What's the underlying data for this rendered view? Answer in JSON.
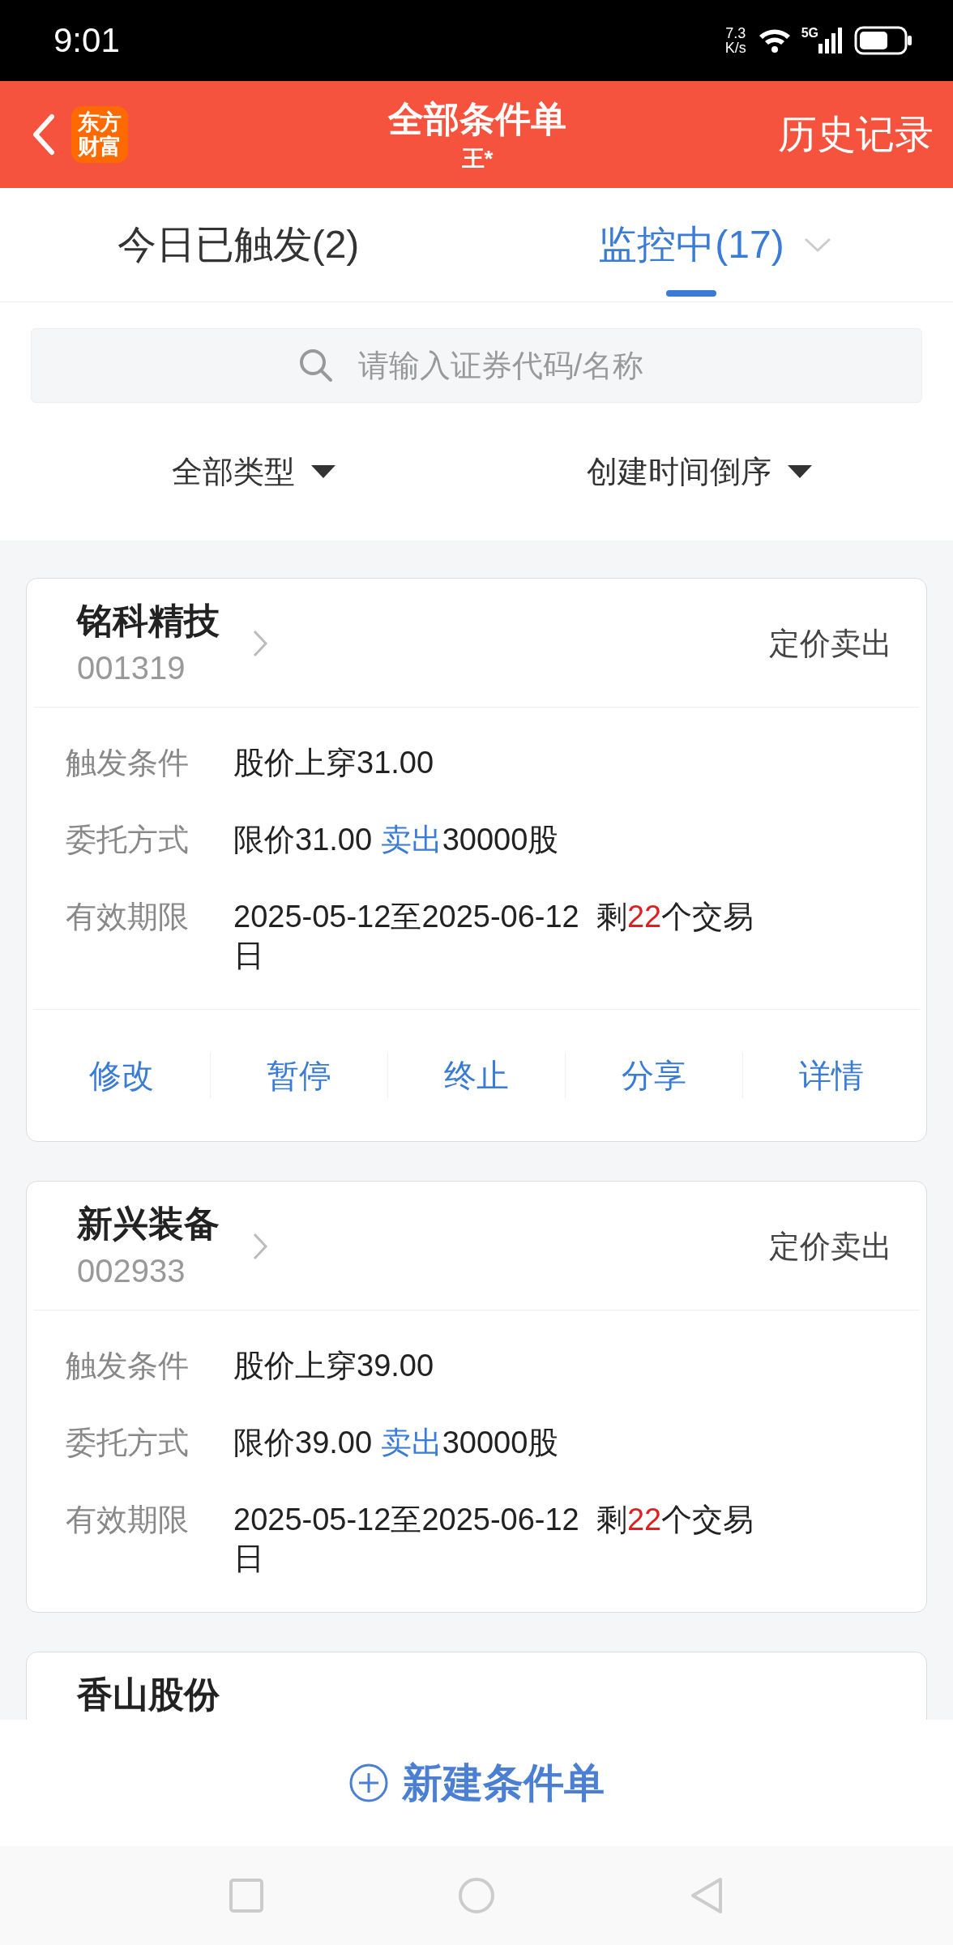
{
  "status_bar": {
    "time": "9:01",
    "speed_value": "7.3",
    "speed_unit": "K/s",
    "network": "5G"
  },
  "header": {
    "logo_text": "东方财富",
    "title": "全部条件单",
    "subtitle": "王*",
    "action": "历史记录"
  },
  "tabs": [
    {
      "label": "今日已触发(2)",
      "selected": false,
      "menu": false
    },
    {
      "label": "监控中(17)",
      "selected": true,
      "menu": true
    }
  ],
  "search": {
    "placeholder": "请输入证券代码/名称"
  },
  "filters": [
    {
      "label": "全部类型"
    },
    {
      "label": "创建时间倒序"
    }
  ],
  "cards": [
    {
      "name": "铭科精技",
      "code": "001319",
      "type": "定价卖出",
      "rows": [
        {
          "label": "触发条件",
          "parts": [
            {
              "text": "股价上穿31.00",
              "color": "#222222"
            }
          ]
        },
        {
          "label": "委托方式",
          "parts": [
            {
              "text": "限价31.00 ",
              "color": "#222222"
            },
            {
              "text": "卖出",
              "color": "#3a7bd5"
            },
            {
              "text": "30000股",
              "color": "#222222"
            }
          ]
        },
        {
          "label": "有效期限",
          "parts": [
            {
              "text": "2025-05-12至2025-06-12  剩",
              "color": "#222222"
            },
            {
              "text": "22",
              "color": "#e02020"
            },
            {
              "text": "个交易日",
              "color": "#222222"
            }
          ]
        }
      ],
      "actions": [
        "修改",
        "暂停",
        "终止",
        "分享",
        "详情"
      ]
    },
    {
      "name": "新兴装备",
      "code": "002933",
      "type": "定价卖出",
      "rows": [
        {
          "label": "触发条件",
          "parts": [
            {
              "text": "股价上穿39.00",
              "color": "#222222"
            }
          ]
        },
        {
          "label": "委托方式",
          "parts": [
            {
              "text": "限价39.00 ",
              "color": "#222222"
            },
            {
              "text": "卖出",
              "color": "#3a7bd5"
            },
            {
              "text": "30000股",
              "color": "#222222"
            }
          ]
        },
        {
          "label": "有效期限",
          "parts": [
            {
              "text": "2025-05-12至2025-06-12  剩",
              "color": "#222222"
            },
            {
              "text": "22",
              "color": "#e02020"
            },
            {
              "text": "个交易日",
              "color": "#222222"
            }
          ]
        }
      ]
    },
    {
      "name": "香山股份"
    }
  ],
  "new_button": {
    "label": "新建条件单"
  }
}
